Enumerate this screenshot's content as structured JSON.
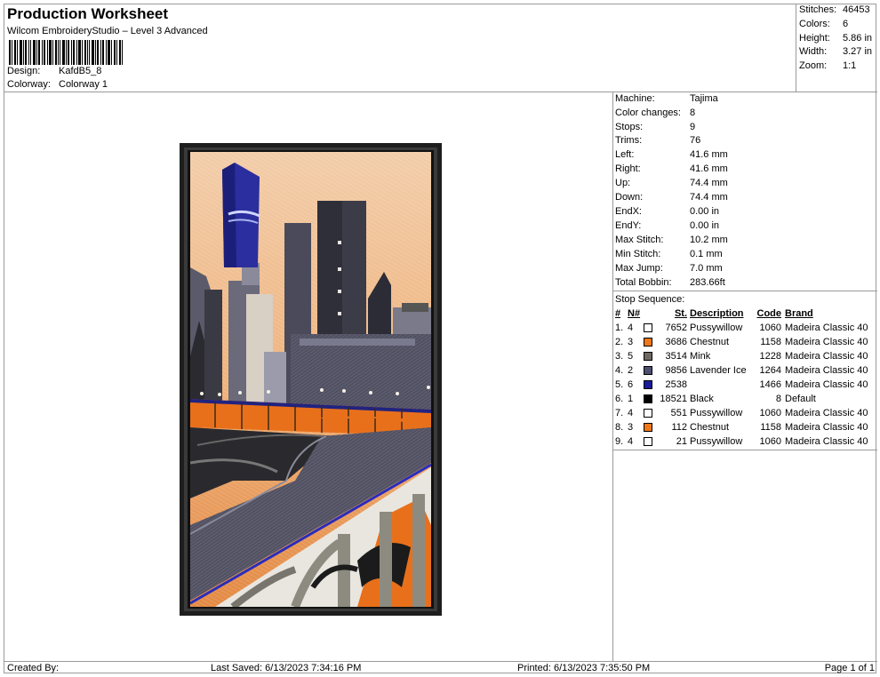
{
  "header": {
    "title": "Production Worksheet",
    "subtitle": "Wilcom EmbroideryStudio – Level 3 Advanced",
    "design_label": "Design:",
    "design_value": "KafdB5_8",
    "colorway_label": "Colorway:",
    "colorway_value": "Colorway 1"
  },
  "summary": [
    {
      "label": "Stitches:",
      "value": "46453"
    },
    {
      "label": "Colors:",
      "value": "6"
    },
    {
      "label": "Height:",
      "value": "5.86 in"
    },
    {
      "label": "Width:",
      "value": "3.27 in"
    },
    {
      "label": "Zoom:",
      "value": "1:1"
    }
  ],
  "machine_info": [
    {
      "label": "Machine:",
      "value": "Tajima"
    },
    {
      "label": "Color changes:",
      "value": "8"
    },
    {
      "label": "Stops:",
      "value": "9"
    },
    {
      "label": "Trims:",
      "value": "76"
    },
    {
      "label": "Left:",
      "value": "41.6 mm"
    },
    {
      "label": "Right:",
      "value": "41.6 mm"
    },
    {
      "label": "Up:",
      "value": "74.4 mm"
    },
    {
      "label": "Down:",
      "value": "74.4 mm"
    },
    {
      "label": "EndX:",
      "value": "0.00 in"
    },
    {
      "label": "EndY:",
      "value": "0.00 in"
    },
    {
      "label": "Max Stitch:",
      "value": "10.2 mm"
    },
    {
      "label": "Min Stitch:",
      "value": "0.1 mm"
    },
    {
      "label": "Max Jump:",
      "value": "7.0 mm"
    },
    {
      "label": "Total Bobbin:",
      "value": "283.66ft"
    }
  ],
  "stop_sequence": {
    "title": "Stop Sequence:",
    "headers": {
      "idx": "#",
      "n": "N#",
      "st": "St.",
      "desc": "Description",
      "code": "Code",
      "brand": "Brand"
    },
    "rows": [
      {
        "idx": "1.",
        "n": "4",
        "color": "#ffffff",
        "st": "7652",
        "desc": "Pussywillow",
        "code": "1060",
        "brand": "Madeira Classic 40"
      },
      {
        "idx": "2.",
        "n": "3",
        "color": "#f07818",
        "st": "3686",
        "desc": "Chestnut",
        "code": "1158",
        "brand": "Madeira Classic 40"
      },
      {
        "idx": "3.",
        "n": "5",
        "color": "#6e6a62",
        "st": "3514",
        "desc": "Mink",
        "code": "1228",
        "brand": "Madeira Classic 40"
      },
      {
        "idx": "4.",
        "n": "2",
        "color": "#4e4e6e",
        "st": "9856",
        "desc": "Lavender Ice",
        "code": "1264",
        "brand": "Madeira Classic 40"
      },
      {
        "idx": "5.",
        "n": "6",
        "color": "#1a1a9a",
        "st": "2538",
        "desc": "",
        "code": "1466",
        "brand": "Madeira Classic 40"
      },
      {
        "idx": "6.",
        "n": "1",
        "color": "#000000",
        "st": "18521",
        "desc": "Black",
        "code": "8",
        "brand": "Default"
      },
      {
        "idx": "7.",
        "n": "4",
        "color": "#ffffff",
        "st": "551",
        "desc": "Pussywillow",
        "code": "1060",
        "brand": "Madeira Classic 40"
      },
      {
        "idx": "8.",
        "n": "3",
        "color": "#f07818",
        "st": "112",
        "desc": "Chestnut",
        "code": "1158",
        "brand": "Madeira Classic 40"
      },
      {
        "idx": "9.",
        "n": "4",
        "color": "#ffffff",
        "st": "21",
        "desc": "Pussywillow",
        "code": "1060",
        "brand": "Madeira Classic 40"
      }
    ]
  },
  "footer": {
    "created_by": "Created By:",
    "last_saved": "Last Saved: 6/13/2023 7:34:16 PM",
    "printed": "Printed: 6/13/2023 7:35:50 PM",
    "page": "Page 1 of 1"
  }
}
